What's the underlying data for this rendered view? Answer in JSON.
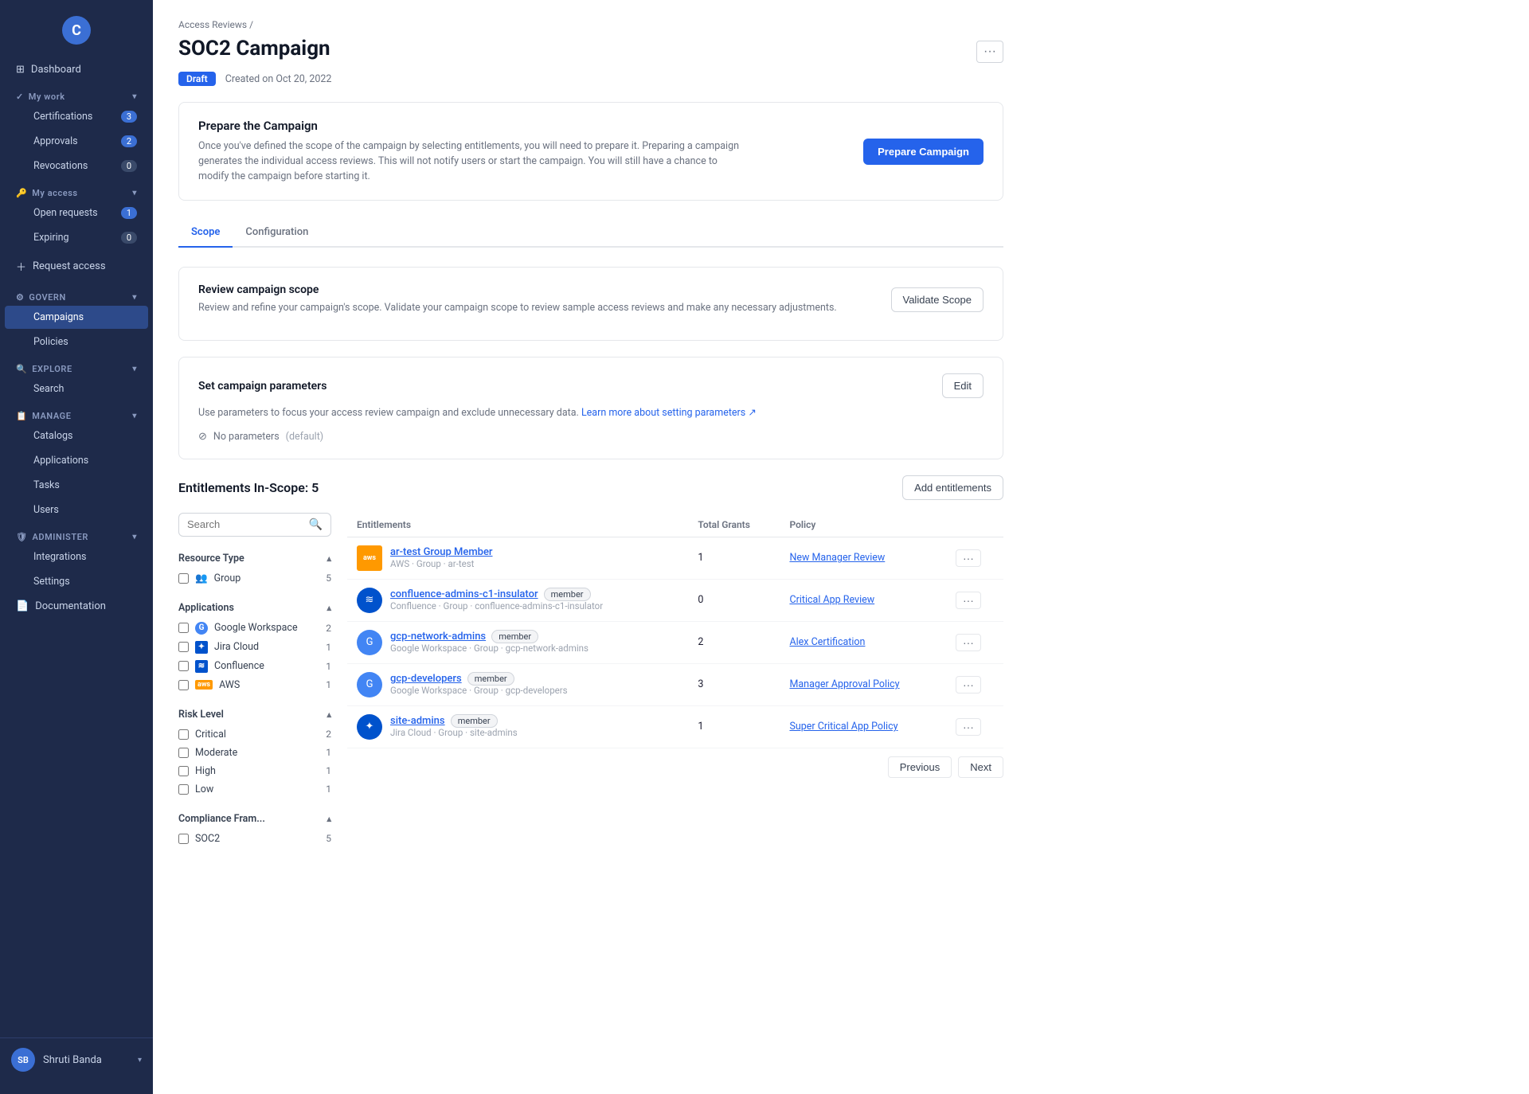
{
  "app": {
    "logo": "C",
    "user": {
      "initials": "SB",
      "name": "Shruti Banda"
    }
  },
  "sidebar": {
    "sections": [
      {
        "id": "dashboard",
        "label": "Dashboard",
        "icon": "⊞",
        "type": "item"
      },
      {
        "id": "my-work",
        "label": "My work",
        "icon": "✓",
        "type": "group",
        "expanded": true,
        "children": [
          {
            "id": "certifications",
            "label": "Certifications",
            "badge": "3"
          },
          {
            "id": "approvals",
            "label": "Approvals",
            "badge": "2"
          },
          {
            "id": "revocations",
            "label": "Revocations",
            "badge": "0",
            "badgeZero": true
          }
        ]
      },
      {
        "id": "my-access",
        "label": "My access",
        "icon": "🔑",
        "type": "group",
        "expanded": true,
        "children": [
          {
            "id": "open-requests",
            "label": "Open requests",
            "badge": "1"
          },
          {
            "id": "expiring",
            "label": "Expiring",
            "badge": "0",
            "badgeZero": true
          }
        ]
      },
      {
        "id": "request-access",
        "label": "Request access",
        "icon": "+",
        "type": "action"
      },
      {
        "id": "govern",
        "label": "GOVERN",
        "icon": "⚙",
        "type": "group",
        "expanded": true,
        "children": [
          {
            "id": "campaigns",
            "label": "Campaigns",
            "active": true
          },
          {
            "id": "policies",
            "label": "Policies"
          }
        ]
      },
      {
        "id": "explore",
        "label": "EXPLORE",
        "icon": "🔍",
        "type": "group",
        "expanded": true,
        "children": [
          {
            "id": "search",
            "label": "Search"
          }
        ]
      },
      {
        "id": "manage",
        "label": "MANAGE",
        "icon": "📋",
        "type": "group",
        "expanded": true,
        "children": [
          {
            "id": "catalogs",
            "label": "Catalogs"
          },
          {
            "id": "applications",
            "label": "Applications"
          },
          {
            "id": "tasks",
            "label": "Tasks"
          },
          {
            "id": "users",
            "label": "Users"
          }
        ]
      },
      {
        "id": "administer",
        "label": "ADMINISTER",
        "icon": "🛡",
        "type": "group",
        "expanded": true,
        "children": [
          {
            "id": "integrations",
            "label": "Integrations"
          },
          {
            "id": "settings",
            "label": "Settings"
          }
        ]
      },
      {
        "id": "documentation",
        "label": "Documentation",
        "icon": "📄",
        "type": "item"
      }
    ]
  },
  "breadcrumb": {
    "parent": "Access Reviews",
    "current": "SOC2 Campaign"
  },
  "page": {
    "title": "SOC2 Campaign",
    "status": "Draft",
    "created": "Created on Oct 20, 2022",
    "more_button": "···"
  },
  "prepare_card": {
    "title": "Prepare the Campaign",
    "description": "Once you've defined the scope of the campaign by selecting entitlements, you will need to prepare it. Preparing a campaign generates the individual access reviews. This will not notify users or start the campaign. You will still have a chance to modify the campaign before starting it.",
    "button": "Prepare Campaign"
  },
  "tabs": [
    {
      "id": "scope",
      "label": "Scope",
      "active": true
    },
    {
      "id": "configuration",
      "label": "Configuration",
      "active": false
    }
  ],
  "scope_section": {
    "title": "Review campaign scope",
    "description": "Review and refine your campaign's scope. Validate your campaign scope to review sample access reviews and make any necessary adjustments.",
    "validate_button": "Validate Scope"
  },
  "parameters_section": {
    "title": "Set campaign parameters",
    "edit_button": "Edit",
    "description": "Use parameters to focus your access review campaign and exclude unnecessary data.",
    "learn_more": "Learn more about setting parameters",
    "no_params_text": "No parameters",
    "default_text": "(default)"
  },
  "entitlements_section": {
    "title": "Entitlements In-Scope: 5",
    "add_button": "Add entitlements",
    "search_placeholder": "Search",
    "filters": {
      "resource_type": {
        "label": "Resource Type",
        "expanded": true,
        "items": [
          {
            "id": "group",
            "label": "Group",
            "count": 5
          }
        ]
      },
      "applications": {
        "label": "Applications",
        "expanded": true,
        "items": [
          {
            "id": "google-workspace",
            "label": "Google Workspace",
            "count": 2,
            "icon": "G"
          },
          {
            "id": "jira-cloud",
            "label": "Jira Cloud",
            "count": 1,
            "icon": "J"
          },
          {
            "id": "confluence",
            "label": "Confluence",
            "count": 1,
            "icon": "C"
          },
          {
            "id": "aws",
            "label": "AWS",
            "count": 1,
            "icon": "aws"
          }
        ]
      },
      "risk_level": {
        "label": "Risk Level",
        "expanded": true,
        "items": [
          {
            "id": "critical",
            "label": "Critical",
            "count": 2
          },
          {
            "id": "moderate",
            "label": "Moderate",
            "count": 1
          },
          {
            "id": "high",
            "label": "High",
            "count": 1
          },
          {
            "id": "low",
            "label": "Low",
            "count": 1
          }
        ]
      },
      "compliance_framework": {
        "label": "Compliance Fram...",
        "expanded": true,
        "items": [
          {
            "id": "soc2",
            "label": "SOC2",
            "count": 5
          }
        ]
      }
    },
    "table": {
      "columns": [
        {
          "id": "entitlements",
          "label": "Entitlements"
        },
        {
          "id": "total_grants",
          "label": "Total Grants"
        },
        {
          "id": "policy",
          "label": "Policy"
        }
      ],
      "rows": [
        {
          "id": "ar-test-group-member",
          "name": "ar-test Group Member",
          "meta": "AWS · Group · ar-test",
          "total_grants": 1,
          "policy": "New Manager Review",
          "has_member_badge": false,
          "icon_type": "aws"
        },
        {
          "id": "confluence-admins-c1-insulator",
          "name": "confluence-admins-c1-insulator",
          "meta": "Confluence · Group · confluence-admins-c1-insulator",
          "total_grants": 0,
          "policy": "Critical App Review",
          "has_member_badge": true,
          "icon_type": "confluence"
        },
        {
          "id": "gcp-network-admins",
          "name": "gcp-network-admins",
          "meta": "Google Workspace · Group · gcp-network-admins",
          "total_grants": 2,
          "policy": "Alex Certification",
          "has_member_badge": true,
          "icon_type": "gcp"
        },
        {
          "id": "gcp-developers",
          "name": "gcp-developers",
          "meta": "Google Workspace · Group · gcp-developers",
          "total_grants": 3,
          "policy": "Manager Approval Policy",
          "has_member_badge": true,
          "icon_type": "gcp"
        },
        {
          "id": "site-admins",
          "name": "site-admins",
          "meta": "Jira Cloud · Group · site-admins",
          "total_grants": 1,
          "policy": "Super Critical App Policy",
          "has_member_badge": true,
          "icon_type": "jira"
        }
      ]
    },
    "pagination": {
      "previous_label": "Previous",
      "next_label": "Next"
    }
  }
}
